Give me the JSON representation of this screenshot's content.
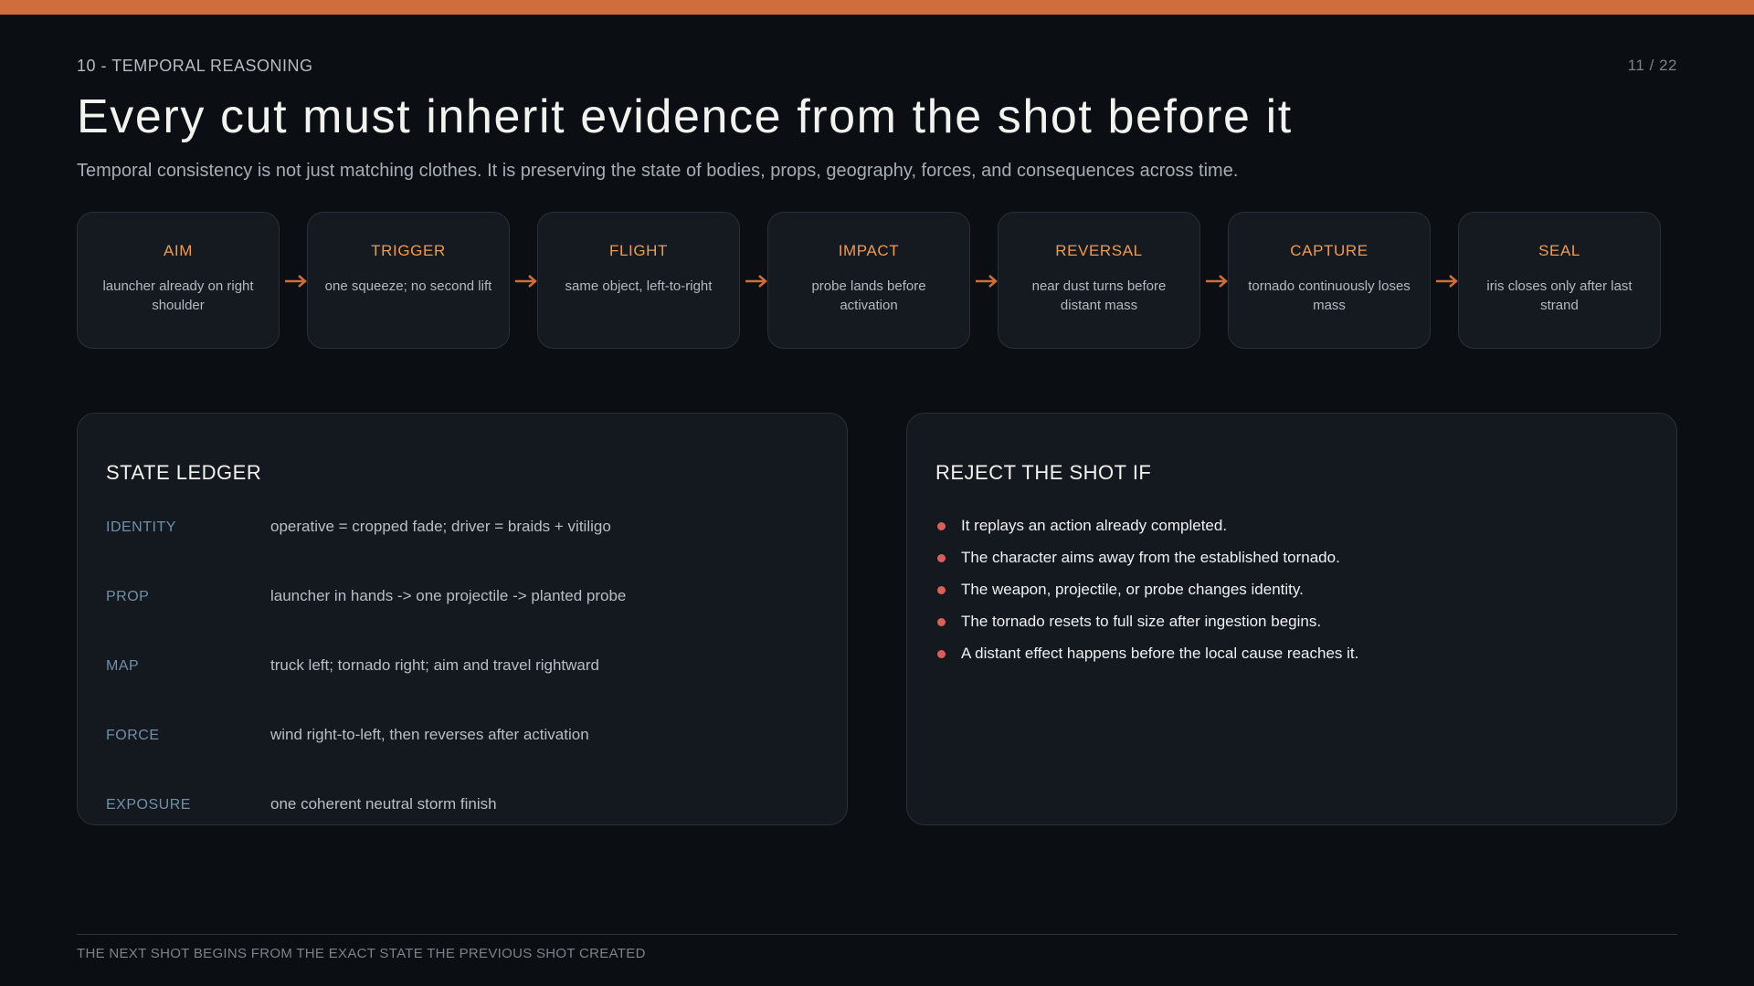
{
  "header": {
    "section": "10 - TEMPORAL REASONING",
    "page": "11 / 22",
    "title": "Every cut must inherit evidence from the shot before it",
    "subtitle": "Temporal consistency is not just matching clothes. It is preserving the state of bodies, props, geography, forces, and consequences across time."
  },
  "pipeline": {
    "stages": [
      {
        "name": "AIM",
        "desc": "launcher already on right shoulder"
      },
      {
        "name": "TRIGGER",
        "desc": "one squeeze; no second lift"
      },
      {
        "name": "FLIGHT",
        "desc": "same object, left-to-right"
      },
      {
        "name": "IMPACT",
        "desc": "probe lands before activation"
      },
      {
        "name": "REVERSAL",
        "desc": "near dust turns before distant mass"
      },
      {
        "name": "CAPTURE",
        "desc": "tornado continuously loses mass"
      },
      {
        "name": "SEAL",
        "desc": "iris closes only after last strand"
      }
    ],
    "connector_icon": "arrow-right-icon"
  },
  "ledger": {
    "heading": "STATE LEDGER",
    "rows": [
      {
        "key": "IDENTITY",
        "value": "operative = cropped fade; driver = braids + vitiligo"
      },
      {
        "key": "PROP",
        "value": "launcher in hands -> one projectile -> planted probe"
      },
      {
        "key": "MAP",
        "value": "truck left; tornado right; aim and travel rightward"
      },
      {
        "key": "FORCE",
        "value": "wind right-to-left, then reverses after activation"
      },
      {
        "key": "EXPOSURE",
        "value": "one coherent neutral storm finish"
      }
    ]
  },
  "reject": {
    "heading": "REJECT THE SHOT IF",
    "items": [
      "It replays an action already completed.",
      "The character aims away from the established tornado.",
      "The weapon, projectile, or probe changes identity.",
      "The tornado resets to full size after ingestion begins.",
      "A distant effect happens before the local cause reaches it."
    ]
  },
  "footer": {
    "text": "THE NEXT SHOT BEGINS FROM THE EXACT STATE THE PREVIOUS SHOT CREATED"
  },
  "colors": {
    "accent": "#cf6d3d",
    "stage_label": "#ef9a4f",
    "bullet": "#d9605a",
    "ledger_key": "#6f90a8",
    "background": "#0b0e12"
  }
}
